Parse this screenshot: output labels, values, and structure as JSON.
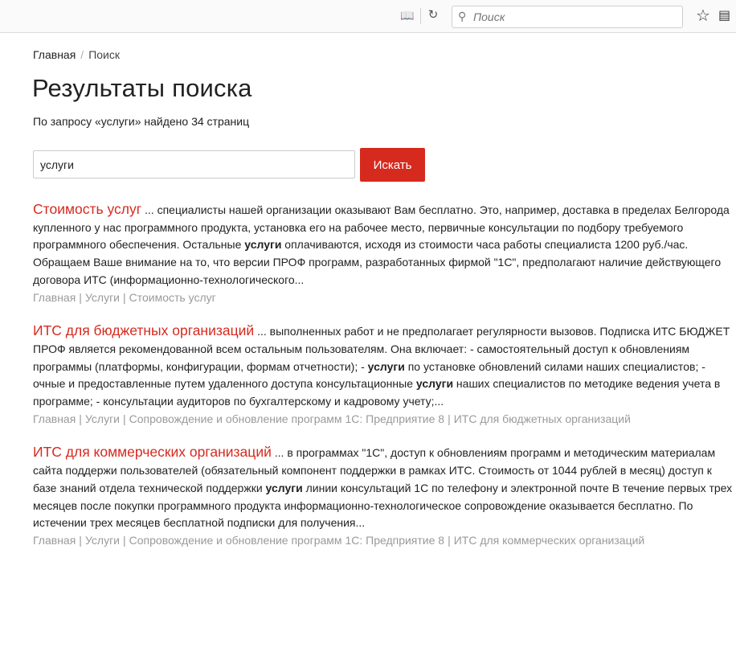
{
  "browser": {
    "search_placeholder": "Поиск"
  },
  "breadcrumb": {
    "home": "Главная",
    "separator": "/",
    "current": "Поиск"
  },
  "page": {
    "title": "Результаты поиска",
    "summary": "По запросу «услуги» найдено 34 страниц"
  },
  "search": {
    "value": "услуги",
    "button_label": "Искать"
  },
  "results": [
    {
      "title": "Стоимость услуг",
      "snippet_parts": [
        {
          "text": " ... специалисты нашей организации оказывают Вам бесплатно. Это, например, доставка в пределах Белгорода купленного у нас программного продукта, установка его на рабочее место, первичные консультации по подбору требуемого программного обеспечения. Остальные ",
          "bold": false
        },
        {
          "text": "услуги",
          "bold": true
        },
        {
          "text": " оплачиваются, исходя из стоимости часа работы специалиста 1200 руб./час. Обращаем Ваше внимание на то, что версии ПРОФ программ, разработанных фирмой \"1С\", предполагают наличие действующего договора ИТС (информационно-технологического...",
          "bold": false
        }
      ],
      "path": [
        "Главная",
        "Услуги",
        "Стоимость услуг"
      ]
    },
    {
      "title": "ИТС для бюджетных организаций",
      "snippet_parts": [
        {
          "text": " ... выполненных работ и не предполагает регулярности вызовов. Подписка ИТС БЮДЖЕТ ПРОФ является рекомендованной всем остальным пользователям. Она включает: - самостоятельный доступ к обновлениям программы (платформы, конфигурации, формам отчетности); - ",
          "bold": false
        },
        {
          "text": "услуги",
          "bold": true
        },
        {
          "text": " по установке обновлений силами наших специалистов; - очные и предоставленные путем удаленного доступа консультационные ",
          "bold": false
        },
        {
          "text": "услуги",
          "bold": true
        },
        {
          "text": " наших специалистов по методике ведения учета в программе; - консультации аудиторов по бухгалтерскому и кадровому учету;...",
          "bold": false
        }
      ],
      "path": [
        "Главная",
        "Услуги",
        "Сопровождение и обновление программ 1С: Предприятие 8",
        "ИТС для бюджетных организаций"
      ]
    },
    {
      "title": "ИТС для коммерческих организаций",
      "snippet_parts": [
        {
          "text": " ... в программах \"1С\", доступ к обновлениям программ и методическим материалам  сайта поддержи пользователей  (обязательный компонент поддержки в рамках ИТС. Стоимость от 1044 рублей в месяц) доступ к базе знаний  отдела технической поддержки ",
          "bold": false
        },
        {
          "text": "услуги",
          "bold": true
        },
        {
          "text": " линии консультаций 1С  по телефону и электронной почте В течение первых трех месяцев после покупки программного продукта информационно-технологическое сопровождение оказывается бесплатно. По истечении трех месяцев бесплатной подписки для получения...",
          "bold": false
        }
      ],
      "path": [
        "Главная",
        "Услуги",
        "Сопровождение и обновление программ 1С: Предприятие 8",
        "ИТС для коммерческих организаций"
      ]
    }
  ]
}
